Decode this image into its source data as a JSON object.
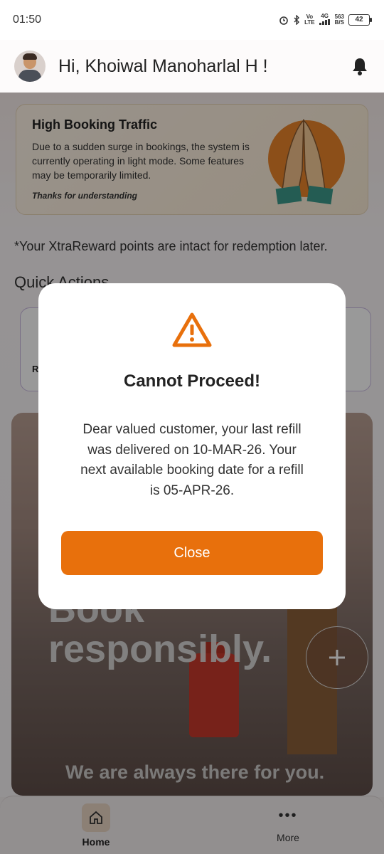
{
  "status_bar": {
    "time": "01:50",
    "network_vo": "Vo",
    "network_lte": "LTE",
    "network_4g": "4G",
    "speed_value": "563",
    "speed_unit": "B/S",
    "battery": "42"
  },
  "header": {
    "greeting": "Hi, Khoiwal Manoharlal H !",
    "icons": [
      "avatar",
      "bell-icon"
    ]
  },
  "banner": {
    "title": "High Booking Traffic",
    "body": "Due to a sudden surge in bookings, the system is currently operating in light mode. Some features may be temporarily limited.",
    "thanks": "Thanks for understanding"
  },
  "reward_note": "*Your XtraReward points are intact for redemption later.",
  "quick_actions": {
    "title": "Quick Actions",
    "first_label": "R"
  },
  "promo": {
    "headline_top": "Book",
    "headline_bottom": "responsibly.",
    "tagline": "We are always there for you."
  },
  "bottom_nav": {
    "items": [
      {
        "label": "Home",
        "icon": "home-icon"
      },
      {
        "label": "More",
        "icon": "more-icon"
      }
    ]
  },
  "dialog": {
    "title": "Cannot Proceed!",
    "message": "Dear valued customer, your last refill was delivered on 10-MAR-26. Your next available booking date for a refill is 05-APR-26.",
    "close_label": "Close",
    "icon": "warning-icon",
    "accent_color": "#e8700c"
  }
}
